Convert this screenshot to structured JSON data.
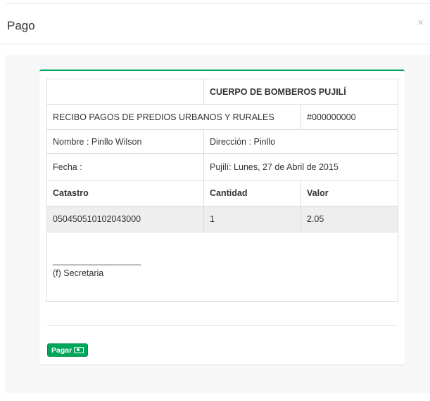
{
  "modal": {
    "title": "Pago",
    "close_label": "×"
  },
  "receipt": {
    "header": "CUERPO DE BOMBEROS PUJILÍ",
    "subtitle": "RECIBO PAGOS DE PREDIOS URBANOS Y RURALES",
    "number": "#000000000",
    "name": "Nombre : Pinllo Wilson",
    "address": "Dirección : Pinllo",
    "date_label": "Fecha :",
    "date_value": "Pujilí: Lunes, 27 de Abril de 2015",
    "columns": [
      "Catastro",
      "Cantidad",
      "Valor"
    ],
    "rows": [
      {
        "catastro": "050450510102043000",
        "cantidad": "1",
        "valor": "2.05"
      }
    ],
    "signature_line": "__________________",
    "signature_label": "(f) Secretaria"
  },
  "actions": {
    "pay_label": "Pagar",
    "pay_icon": "money-bill-icon",
    "accent_color": "#00a65a"
  }
}
